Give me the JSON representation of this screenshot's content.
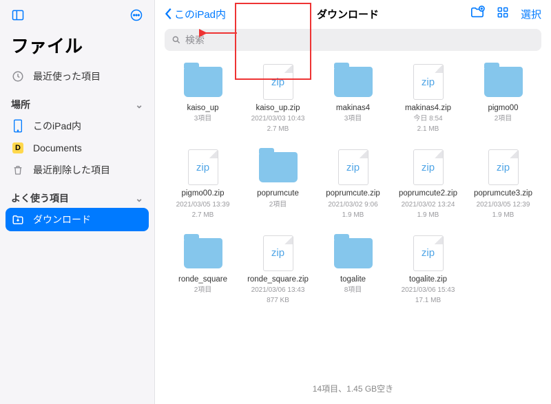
{
  "app_title": "ファイル",
  "sidebar": {
    "recents_label": "最近使った項目",
    "locations_header": "場所",
    "this_ipad_label": "このiPad内",
    "documents_label": "Documents",
    "recently_deleted_label": "最近削除した項目",
    "favorites_header": "よく使う項目",
    "downloads_label": "ダウンロード"
  },
  "topbar": {
    "back_label": "このiPad内",
    "title": "ダウンロード",
    "select_label": "選択"
  },
  "search": {
    "placeholder": "検索"
  },
  "items": [
    {
      "type": "folder",
      "name": "kaiso_up",
      "meta1": "3項目",
      "meta2": ""
    },
    {
      "type": "zip",
      "name": "kaiso_up.zip",
      "meta1": "2021/03/03 10:43",
      "meta2": "2.7 MB"
    },
    {
      "type": "folder",
      "name": "makinas4",
      "meta1": "3項目",
      "meta2": ""
    },
    {
      "type": "zip",
      "name": "makinas4.zip",
      "meta1": "今日 8:54",
      "meta2": "2.1 MB"
    },
    {
      "type": "folder",
      "name": "pigmo00",
      "meta1": "2項目",
      "meta2": ""
    },
    {
      "type": "zip",
      "name": "pigmo00.zip",
      "meta1": "2021/03/05 13:39",
      "meta2": "2.7 MB"
    },
    {
      "type": "folder",
      "name": "poprumcute",
      "meta1": "2項目",
      "meta2": ""
    },
    {
      "type": "zip",
      "name": "poprumcute.zip",
      "meta1": "2021/03/02 9:06",
      "meta2": "1.9 MB"
    },
    {
      "type": "zip",
      "name": "poprumcute2.zip",
      "meta1": "2021/03/02 13:24",
      "meta2": "1.9 MB"
    },
    {
      "type": "zip",
      "name": "poprumcute3.zip",
      "meta1": "2021/03/05 12:39",
      "meta2": "1.9 MB"
    },
    {
      "type": "folder",
      "name": "ronde_square",
      "meta1": "2項目",
      "meta2": ""
    },
    {
      "type": "zip",
      "name": "ronde_square.zip",
      "meta1": "2021/03/06 13:43",
      "meta2": "877 KB"
    },
    {
      "type": "folder",
      "name": "togalite",
      "meta1": "8項目",
      "meta2": ""
    },
    {
      "type": "zip",
      "name": "togalite.zip",
      "meta1": "2021/03/06 15:43",
      "meta2": "17.1 MB"
    }
  ],
  "zip_badge": "zip",
  "status": "14項目、1.45 GB空き",
  "annotation": {
    "highlighted_index": 3
  }
}
